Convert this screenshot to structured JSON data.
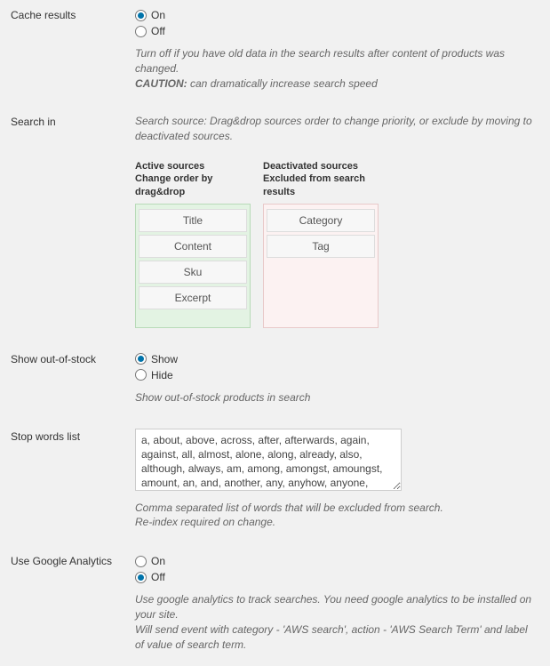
{
  "cache_results": {
    "label": "Cache results",
    "on": "On",
    "off": "Off",
    "selected": "on",
    "desc_line1": "Turn off if you have old data in the search results after content of products was changed.",
    "caution_label": "CAUTION:",
    "caution_text": " can dramatically increase search speed"
  },
  "search_in": {
    "label": "Search in",
    "desc": "Search source: Drag&drop sources order to change priority, or exclude by moving to deactivated sources.",
    "active_head1": "Active sources",
    "active_head2": "Change order by drag&drop",
    "deact_head1": "Deactivated sources",
    "deact_head2": "Excluded from search results",
    "active": [
      "Title",
      "Content",
      "Sku",
      "Excerpt"
    ],
    "deactivated": [
      "Category",
      "Tag"
    ]
  },
  "out_of_stock": {
    "label": "Show out-of-stock",
    "show": "Show",
    "hide": "Hide",
    "selected": "show",
    "desc": "Show out-of-stock products in search"
  },
  "stop_words": {
    "label": "Stop words list",
    "value": "a, about, above, across, after, afterwards, again, against, all, almost, alone, along, already, also, although, always, am, among, amongst, amoungst, amount, an, and, another, any, anyhow, anyone, anything, anyway, anywhere, are, around, as,",
    "desc_line1": "Comma separated list of words that will be excluded from search.",
    "desc_line2": "Re-index required on change."
  },
  "google_analytics": {
    "label": "Use Google Analytics",
    "on": "On",
    "off": "Off",
    "selected": "off",
    "desc_line1": "Use google analytics to track searches. You need google analytics to be installed on your site.",
    "desc_line2": "Will send event with category - 'AWS search', action - 'AWS Search Term' and label of value of search term."
  }
}
